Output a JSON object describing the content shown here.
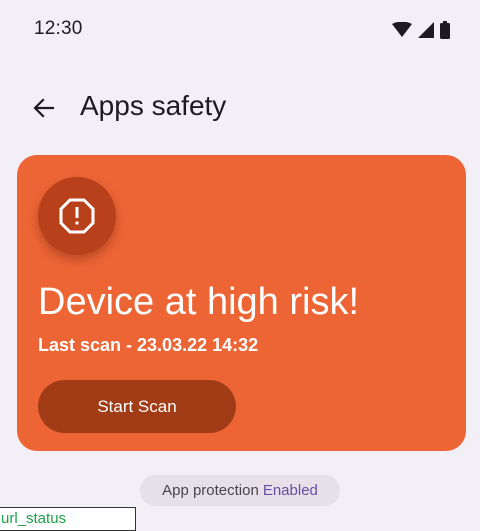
{
  "status_bar": {
    "time": "12:30",
    "icons": [
      "wifi-icon",
      "signal-icon",
      "battery-icon"
    ]
  },
  "header": {
    "back_icon": "arrow-back-icon",
    "title": "Apps safety"
  },
  "risk_card": {
    "icon": "alert-octagon-icon",
    "title": "Device at high risk!",
    "last_scan": "Last scan - 23.03.22 14:32",
    "button_label": "Start Scan"
  },
  "protection_chip": {
    "label": "App protection",
    "status": "Enabled"
  },
  "overlay_label": "url_status",
  "colors": {
    "background": "#f3eff6",
    "card": "#ed6535",
    "icon_circle": "#b8411c",
    "button": "#a23c16",
    "chip": "#e6e0e9",
    "chip_status": "#6750a4",
    "overlay_text": "#1aa14a"
  }
}
